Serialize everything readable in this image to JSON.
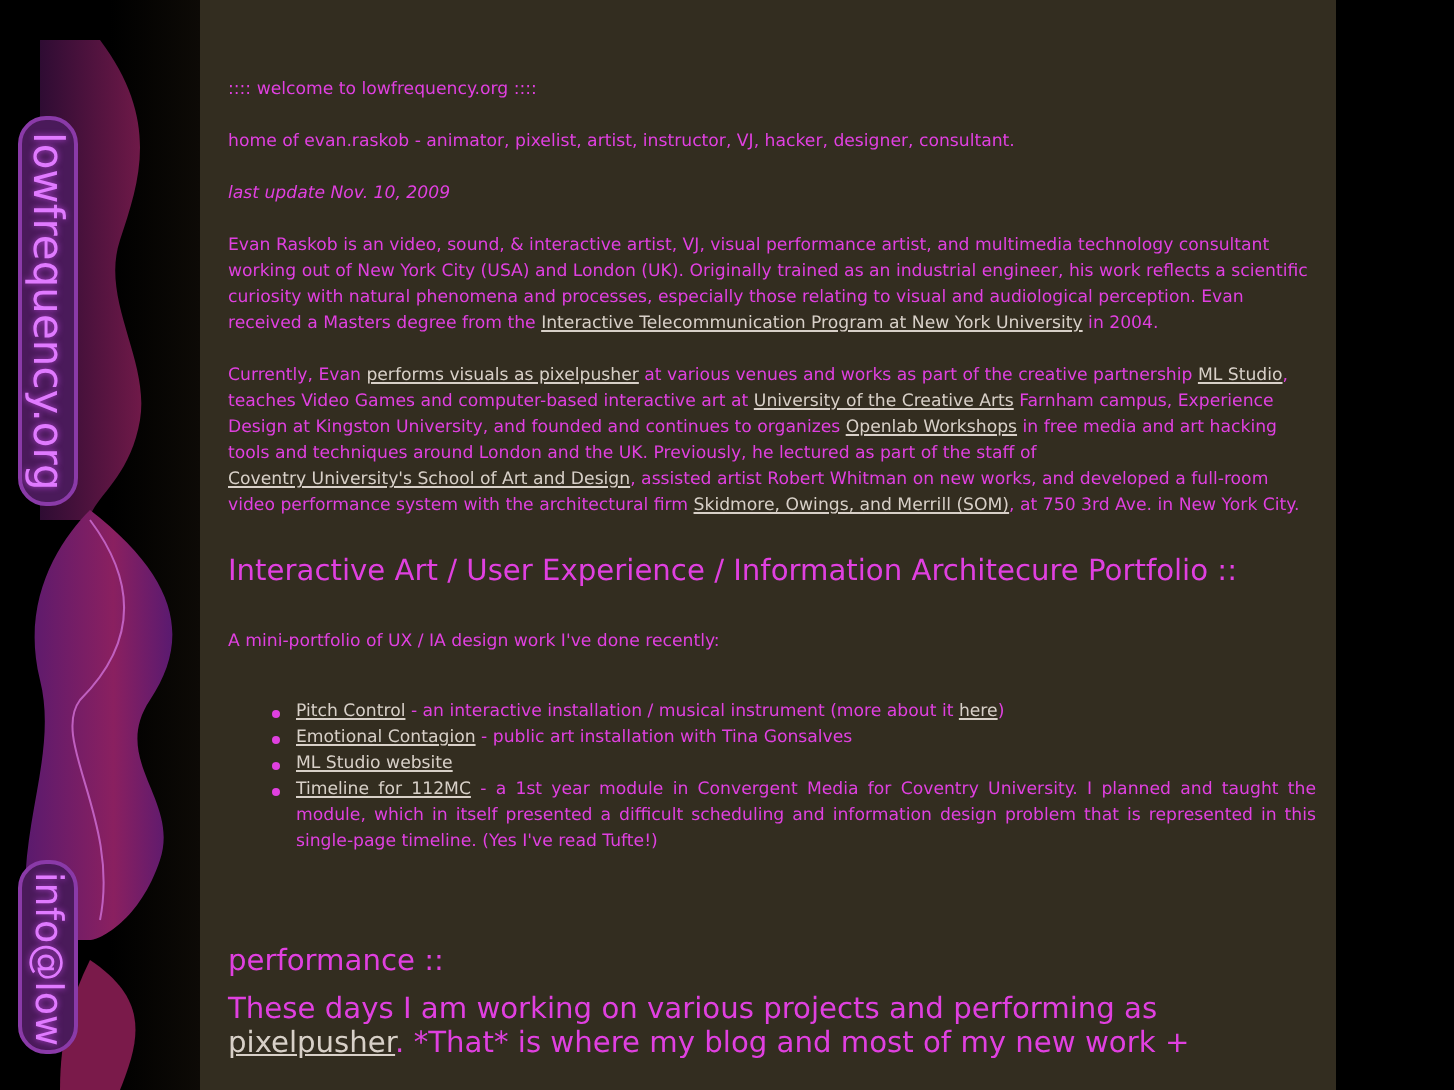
{
  "banner": {
    "title": "lowfrequency.org",
    "contact": "info@low"
  },
  "welcome": ":::: welcome to lowfrequency.org ::::",
  "tagline": "home of evan.raskob - animator, pixelist, artist, instructor, VJ, hacker, designer, consultant.",
  "last_update": "last update Nov. 10, 2009",
  "paragraphs": [
    [
      {
        "kind": "text",
        "text": "Evan Raskob is an video, sound, & interactive artist, VJ, visual performance artist, and multimedia technology consultant working out of New York City (USA) and London (UK). Originally trained as an industrial engineer, his work reflects a scientific curiosity with natural phenomena and processes, especially those relating to visual and audiological perception. Evan received a Masters degree from the "
      },
      {
        "kind": "link",
        "text": "Interactive Telecommunication Program at New York University"
      },
      {
        "kind": "text",
        "text": " in 2004."
      }
    ],
    [
      {
        "kind": "text",
        "text": "Currently, Evan "
      },
      {
        "kind": "link",
        "text": "performs visuals as pixelpusher"
      },
      {
        "kind": "text",
        "text": " at various venues and works as part of the creative partnership "
      },
      {
        "kind": "link",
        "text": "ML Studio"
      },
      {
        "kind": "text",
        "text": ", teaches Video Games and computer-based interactive art at "
      },
      {
        "kind": "link",
        "text": "University of the Creative Arts"
      },
      {
        "kind": "text",
        "text": " Farnham campus, Experience Design at Kingston University, and founded and continues to organizes "
      },
      {
        "kind": "link",
        "text": "Openlab Workshops"
      },
      {
        "kind": "text",
        "text": " in free media and art hacking tools and techniques around London and the UK. Previously, he lectured as part of the staff of "
      },
      {
        "kind": "link",
        "text": "Coventry University's School of Art and Design"
      },
      {
        "kind": "text",
        "text": ", assisted artist Robert Whitman on new works, and developed a full-room video performance system with the architectural firm "
      },
      {
        "kind": "link",
        "text": "Skidmore, Owings, and Merrill (SOM)"
      },
      {
        "kind": "text",
        "text": ", at 750 3rd Ave. in New York City."
      }
    ]
  ],
  "portfolio": {
    "heading": "Interactive Art / User Experience / Information Architecure Portfolio ::",
    "intro": "A mini-portfolio of UX / IA design work I've done recently:",
    "items": [
      [
        {
          "kind": "link",
          "text": "Pitch Control"
        },
        {
          "kind": "text",
          "text": " - an interactive installation / musical instrument (more about it "
        },
        {
          "kind": "link",
          "text": "here"
        },
        {
          "kind": "text",
          "text": ")"
        }
      ],
      [
        {
          "kind": "link",
          "text": "Emotional Contagion"
        },
        {
          "kind": "text",
          "text": " - public art installation with Tina Gonsalves"
        }
      ],
      [
        {
          "kind": "link",
          "text": "ML Studio website"
        }
      ],
      [
        {
          "kind": "link",
          "text": "Timeline for 112MC"
        },
        {
          "kind": "text",
          "text": " - a 1st year module in Convergent Media for Coventry University. I planned and taught the module, which in itself presented a difficult scheduling and information design problem that is represented in this single-page timeline. (Yes I've read Tufte!)"
        }
      ]
    ]
  },
  "performance": {
    "heading": "performance ::",
    "text": [
      {
        "kind": "text",
        "text": "These days I am working on various projects and performing as "
      },
      {
        "kind": "link",
        "text": "pixelpusher"
      },
      {
        "kind": "text",
        "text": ". *That* is where my blog and most of my new work +"
      }
    ]
  }
}
